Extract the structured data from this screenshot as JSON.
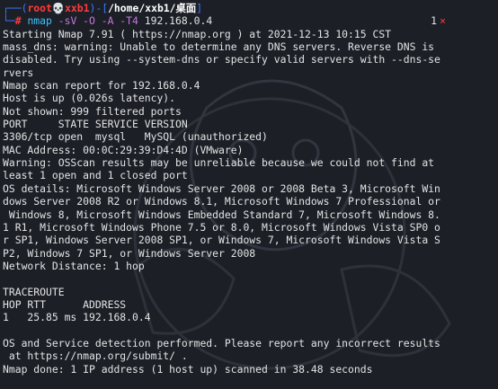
{
  "prompt": {
    "corner_top": "┌──(",
    "user": "root",
    "skull": "💀",
    "host": "xxb1",
    "close_paren": ")-[",
    "path": "/home/xxb1/桌面",
    "close_bracket": "]",
    "corner_bottom": "└─",
    "hash": "#",
    "command": "nmap",
    "args": "-sV -O -A -T4",
    "target": "192.168.0.4",
    "status_count": "1",
    "status_icon": "×"
  },
  "output_lines": [
    "Starting Nmap 7.91 ( https://nmap.org ) at 2021-12-13 10:15 CST",
    "mass_dns: warning: Unable to determine any DNS servers. Reverse DNS is",
    "disabled. Try using --system-dns or specify valid servers with --dns-se",
    "rvers",
    "Nmap scan report for 192.168.0.4",
    "Host is up (0.026s latency).",
    "Not shown: 999 filtered ports",
    "PORT     STATE SERVICE VERSION",
    "3306/tcp open  mysql   MySQL (unauthorized)",
    "MAC Address: 00:0C:29:39:D4:4D (VMware)",
    "Warning: OSScan results may be unreliable because we could not find at",
    "least 1 open and 1 closed port",
    "OS details: Microsoft Windows Server 2008 or 2008 Beta 3, Microsoft Win",
    "dows Server 2008 R2 or Windows 8.1, Microsoft Windows 7 Professional or",
    " Windows 8, Microsoft Windows Embedded Standard 7, Microsoft Windows 8.",
    "1 R1, Microsoft Windows Phone 7.5 or 8.0, Microsoft Windows Vista SP0 o",
    "r SP1, Windows Server 2008 SP1, or Windows 7, Microsoft Windows Vista S",
    "P2, Windows 7 SP1, or Windows Server 2008",
    "Network Distance: 1 hop",
    "",
    "TRACEROUTE",
    "HOP RTT      ADDRESS",
    "1   25.85 ms 192.168.0.4",
    "",
    "OS and Service detection performed. Please report any incorrect results",
    " at https://nmap.org/submit/ .",
    "Nmap done: 1 IP address (1 host up) scanned in 38.48 seconds"
  ],
  "colors": {
    "background": "#1c1f26",
    "text": "#e4e4e4",
    "prompt_red": "#ff3b3b",
    "prompt_blue": "#3b78ff",
    "command_cyan": "#3fc1ff",
    "arg_purple": "#c678dd"
  }
}
